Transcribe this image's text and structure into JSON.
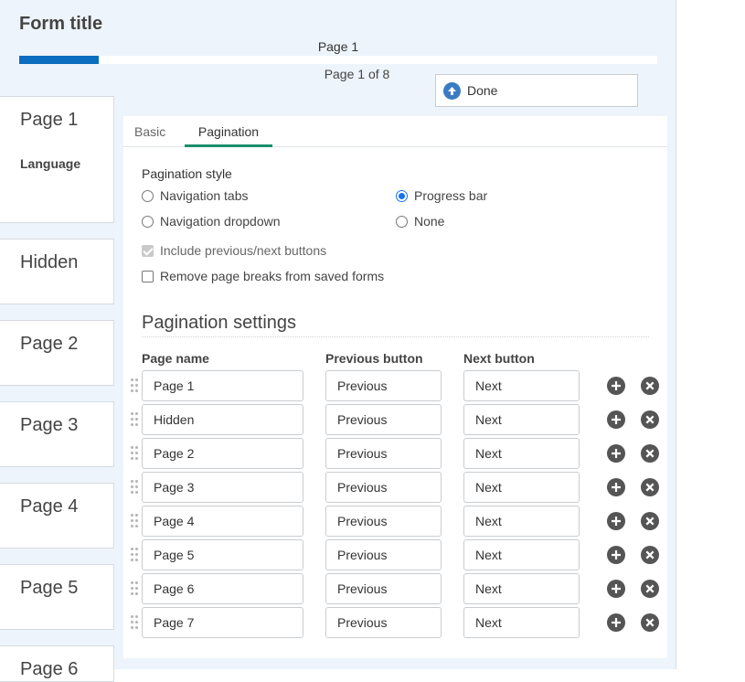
{
  "form": {
    "title": "Form title",
    "progress_label": "Page 1",
    "progress_count": "Page 1 of 8",
    "progress_fraction": 0.125,
    "done_label": "Done"
  },
  "pages_sidebar": [
    {
      "name": "Page 1",
      "sub": "Language"
    },
    {
      "name": "Hidden"
    },
    {
      "name": "Page 2"
    },
    {
      "name": "Page 3"
    },
    {
      "name": "Page 4"
    },
    {
      "name": "Page 5"
    },
    {
      "name": "Page 6"
    }
  ],
  "tabs": [
    {
      "label": "Basic",
      "active": false
    },
    {
      "label": "Pagination",
      "active": true
    }
  ],
  "pagination_style": {
    "label": "Pagination style",
    "options": [
      {
        "label": "Navigation tabs",
        "selected": false
      },
      {
        "label": "Progress bar",
        "selected": true
      },
      {
        "label": "Navigation dropdown",
        "selected": false
      },
      {
        "label": "None",
        "selected": false
      }
    ]
  },
  "checkboxes": [
    {
      "label": "Include previous/next buttons",
      "checked": true,
      "disabled": true
    },
    {
      "label": "Remove page breaks from saved forms",
      "checked": false,
      "disabled": false
    }
  ],
  "settings": {
    "title": "Pagination settings",
    "headers": {
      "name": "Page name",
      "prev": "Previous button",
      "next": "Next button"
    },
    "rows": [
      {
        "name": "Page 1",
        "prev": "Previous",
        "next": "Next"
      },
      {
        "name": "Hidden",
        "prev": "Previous",
        "next": "Next"
      },
      {
        "name": "Page 2",
        "prev": "Previous",
        "next": "Next"
      },
      {
        "name": "Page 3",
        "prev": "Previous",
        "next": "Next"
      },
      {
        "name": "Page 4",
        "prev": "Previous",
        "next": "Next"
      },
      {
        "name": "Page 5",
        "prev": "Previous",
        "next": "Next"
      },
      {
        "name": "Page 6",
        "prev": "Previous",
        "next": "Next"
      },
      {
        "name": "Page 7",
        "prev": "Previous",
        "next": "Next"
      }
    ]
  },
  "colors": {
    "accent": "#0b6dbf",
    "tab_underline": "#1a8f6a",
    "radio_selected": "#1a73e8"
  }
}
